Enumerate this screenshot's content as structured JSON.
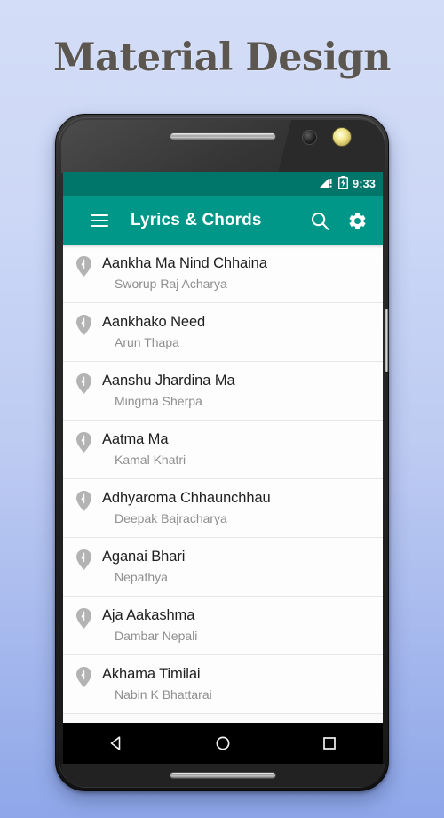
{
  "headline": "Material Design",
  "theme": {
    "accent": "#009688",
    "statusbar": "#00756a",
    "background_top": "#d3ddf7",
    "background_bottom": "#8fa7e9",
    "title_color": "#5b5650"
  },
  "phone": {
    "statusbar": {
      "signal_icon": "signal-warning-icon",
      "battery_icon": "battery-charging-icon",
      "time": "9:33"
    },
    "appbar": {
      "menu_icon": "hamburger-menu-icon",
      "title": "Lyrics & Chords",
      "search_icon": "search-icon",
      "settings_icon": "gear-icon"
    },
    "list": {
      "item_icon": "pin-music-icon",
      "items": [
        {
          "title": "Aankha Ma Nind Chhaina",
          "artist": "Sworup Raj Acharya"
        },
        {
          "title": "Aankhako Need",
          "artist": "Arun Thapa"
        },
        {
          "title": "Aanshu Jhardina Ma",
          "artist": "Mingma Sherpa"
        },
        {
          "title": "Aatma Ma",
          "artist": "Kamal Khatri"
        },
        {
          "title": "Adhyaroma Chhaunchhau",
          "artist": "Deepak Bajracharya"
        },
        {
          "title": "Aganai Bhari",
          "artist": "Nepathya"
        },
        {
          "title": "Aja Aakashma",
          "artist": "Dambar Nepali"
        },
        {
          "title": "Akhama Timilai",
          "artist": "Nabin K Bhattarai"
        }
      ]
    },
    "navbar": {
      "back_icon": "back-triangle-icon",
      "home_icon": "home-circle-icon",
      "recents_icon": "recents-square-icon"
    }
  }
}
